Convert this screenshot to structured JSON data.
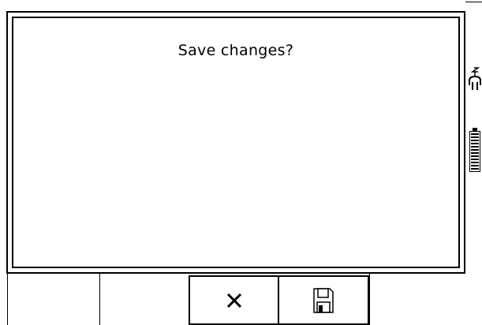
{
  "dialog": {
    "message": "Save changes?"
  },
  "status": {
    "icons": [
      "power-plug-icon",
      "battery-icon"
    ]
  },
  "softkeys": [
    {
      "slot": 1,
      "icon": ""
    },
    {
      "slot": 2,
      "icon": ""
    },
    {
      "slot": 3,
      "icon": "close-icon"
    },
    {
      "slot": 4,
      "icon": "save-disk-icon"
    },
    {
      "slot": 5,
      "icon": ""
    }
  ]
}
